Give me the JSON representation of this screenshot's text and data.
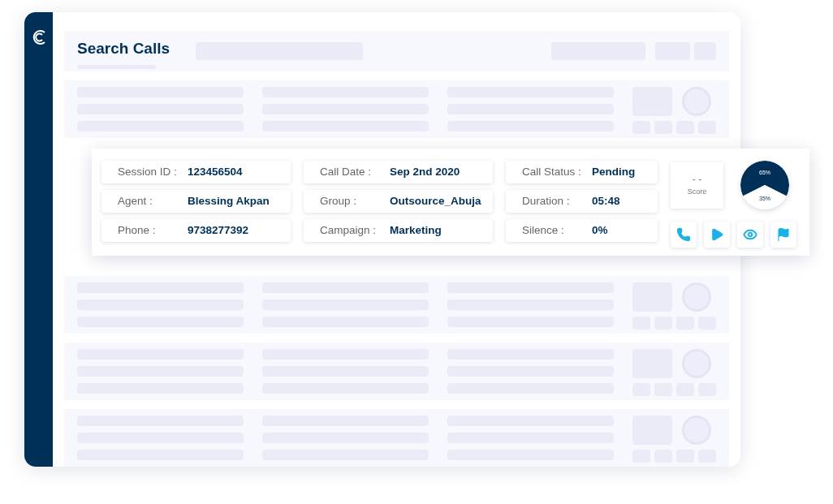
{
  "header": {
    "title": "Search Calls"
  },
  "call_card": {
    "columns": [
      [
        {
          "label": "Session ID :",
          "value": "123456504"
        },
        {
          "label": "Agent :",
          "value": "Blessing Akpan"
        },
        {
          "label": "Phone :",
          "value": "9738277392"
        }
      ],
      [
        {
          "label": "Call Date :",
          "value": "Sep 2nd 2020"
        },
        {
          "label": "Group :",
          "value": "Outsource_Abuja"
        },
        {
          "label": "Campaign :",
          "value": "Marketing"
        }
      ],
      [
        {
          "label": "Call Status :",
          "value": "Pending"
        },
        {
          "label": "Duration :",
          "value": "05:48"
        },
        {
          "label": "Silence :",
          "value": "0%"
        }
      ]
    ],
    "score": {
      "value": "- -",
      "label": "Score"
    },
    "chart_data": {
      "type": "pie",
      "values": [
        65,
        35
      ],
      "value_labels": [
        "65%",
        "35%"
      ]
    },
    "actions": [
      {
        "kind": "call"
      },
      {
        "kind": "play"
      },
      {
        "kind": "view"
      },
      {
        "kind": "flag"
      }
    ]
  }
}
